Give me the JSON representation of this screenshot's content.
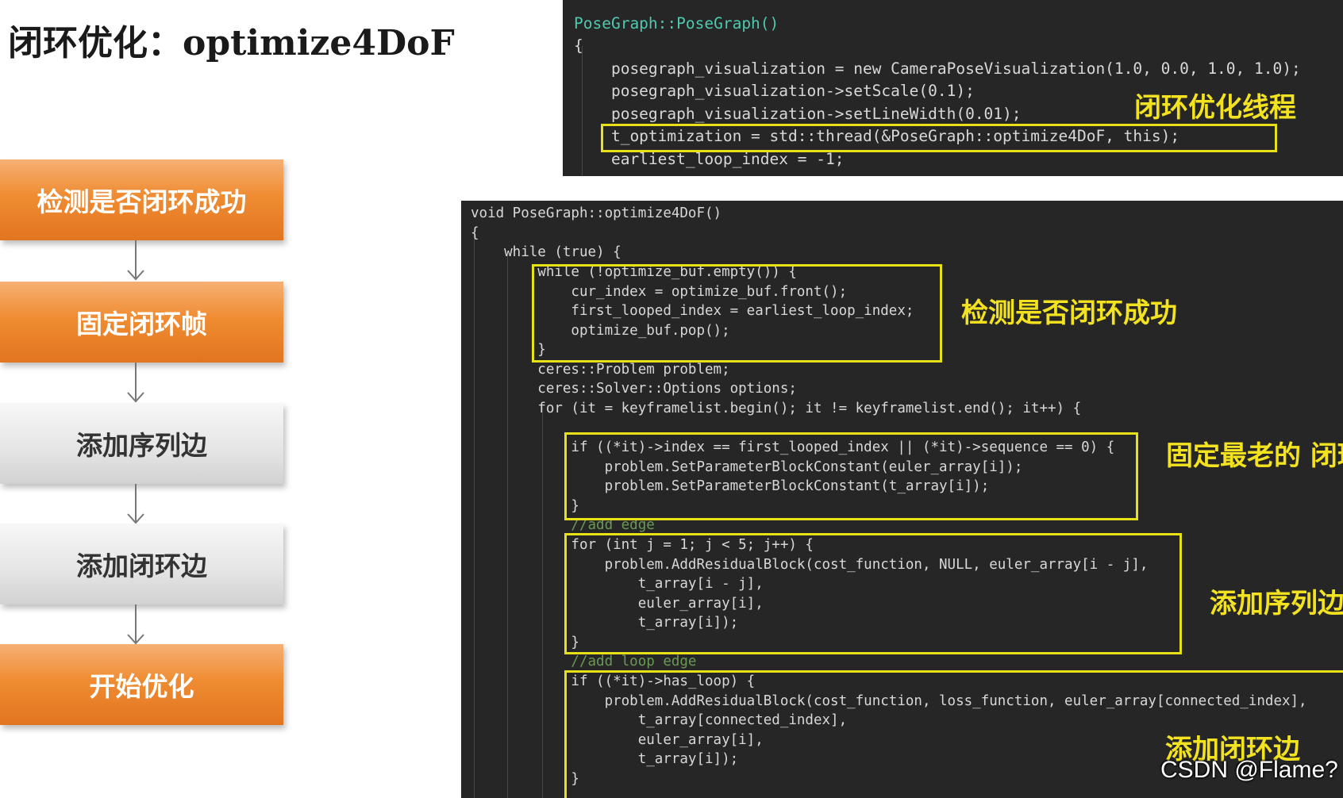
{
  "title": "闭环优化：optimize4DoF",
  "flowchart": {
    "steps": [
      {
        "label": "检测是否闭环成功",
        "style": "orange"
      },
      {
        "label": "固定闭环帧",
        "style": "orange"
      },
      {
        "label": "添加序列边",
        "style": "grey"
      },
      {
        "label": "添加闭环边",
        "style": "grey"
      },
      {
        "label": "开始优化",
        "style": "orange"
      }
    ]
  },
  "constructor_code": {
    "lines": [
      "PoseGraph::PoseGraph()",
      "{",
      "    posegraph_visualization = new CameraPoseVisualization(1.0, 0.0, 1.0, 1.0);",
      "    posegraph_visualization->setScale(0.1);",
      "    posegraph_visualization->setLineWidth(0.01);",
      "    t_optimization = std::thread(&PoseGraph::optimize4DoF, this);",
      "    earliest_loop_index = -1;"
    ],
    "annotation": "闭环优化线程"
  },
  "optimize_code": {
    "lines": [
      "void PoseGraph::optimize4DoF()",
      "{",
      "    while (true) {",
      "        while (!optimize_buf.empty()) {",
      "            cur_index = optimize_buf.front();",
      "            first_looped_index = earliest_loop_index;",
      "            optimize_buf.pop();",
      "        }",
      "        ceres::Problem problem;",
      "        ceres::Solver::Options options;",
      "        for (it = keyframelist.begin(); it != keyframelist.end(); it++) {",
      "",
      "            if ((*it)->index == first_looped_index || (*it)->sequence == 0) {",
      "                problem.SetParameterBlockConstant(euler_array[i]);",
      "                problem.SetParameterBlockConstant(t_array[i]);",
      "            }",
      "            //add edge",
      "            for (int j = 1; j < 5; j++) {",
      "                problem.AddResidualBlock(cost_function, NULL, euler_array[i - j],",
      "                    t_array[i - j],",
      "                    euler_array[i],",
      "                    t_array[i]);",
      "            }",
      "            //add loop edge",
      "            if ((*it)->has_loop) {",
      "                problem.AddResidualBlock(cost_function, loss_function, euler_array[connected_index],",
      "                    t_array[connected_index],",
      "                    euler_array[i],",
      "                    t_array[i]);",
      "            }"
    ],
    "annotations": [
      "检测是否闭环成功",
      "固定最老的\n闭环帧",
      "添加序列边",
      "添加闭环边"
    ]
  },
  "watermark": "CSDN @Flame?"
}
